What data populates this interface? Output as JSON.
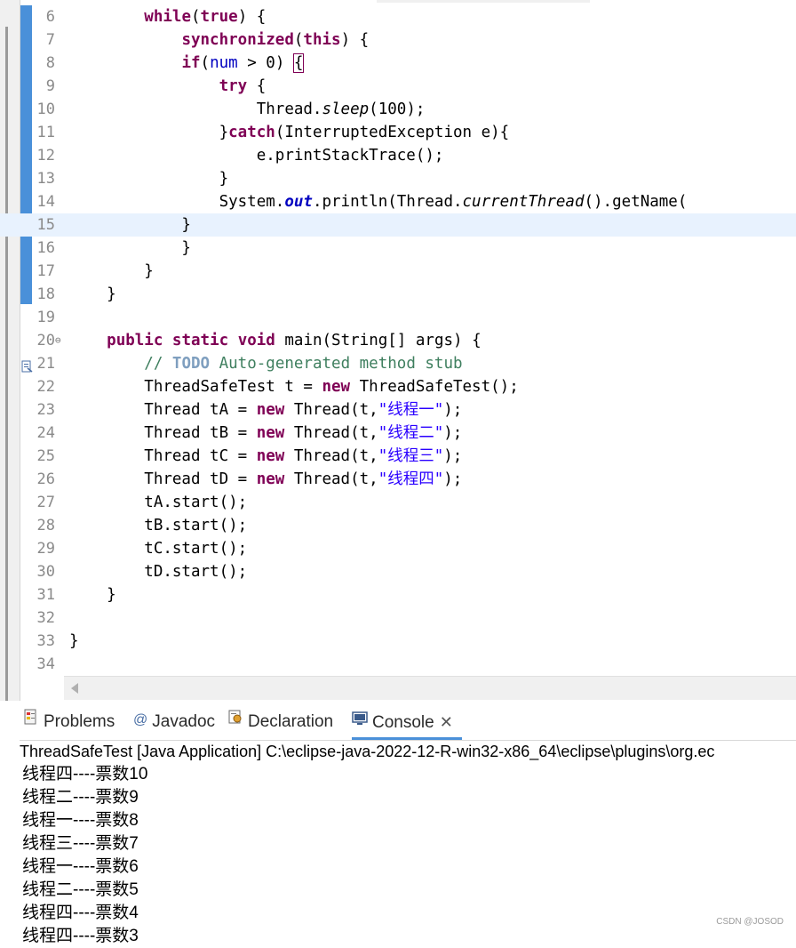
{
  "editor": {
    "lines": [
      {
        "n": "6",
        "html": "        <span class=\"kw\">while</span>(<span class=\"kw\">true</span>) {"
      },
      {
        "n": "7",
        "html": "            <span class=\"kw\">synchronized</span>(<span class=\"kw\">this</span>) {"
      },
      {
        "n": "8",
        "html": "            <span class=\"kw\">if</span>(<span class=\"fld\">num</span> &gt; 0) <span class=\"brk\">{</span>"
      },
      {
        "n": "9",
        "html": "                <span class=\"kw\">try</span> {"
      },
      {
        "n": "10",
        "html": "                    Thread.<span class=\"it\">sleep</span>(100);"
      },
      {
        "n": "11",
        "html": "                }<span class=\"kw\">catch</span>(InterruptedException e){"
      },
      {
        "n": "12",
        "html": "                    e.printStackTrace();"
      },
      {
        "n": "13",
        "html": "                }"
      },
      {
        "n": "14",
        "html": "                System.<span class=\"sf\">out</span>.println(Thread.<span class=\"it\">currentThread</span>().getName("
      },
      {
        "n": "15",
        "html": "            }",
        "current": true
      },
      {
        "n": "16",
        "html": "            }"
      },
      {
        "n": "17",
        "html": "        }"
      },
      {
        "n": "18",
        "html": "    }"
      },
      {
        "n": "19",
        "html": ""
      },
      {
        "n": "20",
        "html": "    <span class=\"kw\">public</span> <span class=\"kw\">static</span> <span class=\"kw\">void</span> main(String[] args) {",
        "fold": "⊖"
      },
      {
        "n": "21",
        "html": "        <span class=\"cm\">// </span><span class=\"td\">TODO</span><span class=\"cm\"> Auto-generated method stub</span>",
        "marker": true
      },
      {
        "n": "22",
        "html": "        ThreadSafeTest t = <span class=\"kw\">new</span> ThreadSafeTest();"
      },
      {
        "n": "23",
        "html": "        Thread tA = <span class=\"kw\">new</span> Thread(t,<span class=\"st\">\"线程一\"</span>);"
      },
      {
        "n": "24",
        "html": "        Thread tB = <span class=\"kw\">new</span> Thread(t,<span class=\"st\">\"线程二\"</span>);"
      },
      {
        "n": "25",
        "html": "        Thread tC = <span class=\"kw\">new</span> Thread(t,<span class=\"st\">\"线程三\"</span>);"
      },
      {
        "n": "26",
        "html": "        Thread tD = <span class=\"kw\">new</span> Thread(t,<span class=\"st\">\"线程四\"</span>);"
      },
      {
        "n": "27",
        "html": "        tA.start();"
      },
      {
        "n": "28",
        "html": "        tB.start();"
      },
      {
        "n": "29",
        "html": "        tC.start();"
      },
      {
        "n": "30",
        "html": "        tD.start();"
      },
      {
        "n": "31",
        "html": "    }"
      },
      {
        "n": "32",
        "html": ""
      },
      {
        "n": "33",
        "html": "}"
      },
      {
        "n": "34",
        "html": ""
      }
    ]
  },
  "tabs": {
    "problems": "Problems",
    "javadoc": "Javadoc",
    "declaration": "Declaration",
    "console": "Console",
    "close": "✕"
  },
  "console": {
    "title": "ThreadSafeTest [Java Application] C:\\eclipse-java-2022-12-R-win32-x86_64\\eclipse\\plugins\\org.ec",
    "output": [
      "线程四----票数10",
      "线程二----票数9",
      "线程一----票数8",
      "线程三----票数7",
      "线程一----票数6",
      "线程二----票数5",
      "线程四----票数4",
      "线程四----票数3"
    ]
  },
  "watermark": "CSDN @JOSOD",
  "colors": {
    "keyword": "#7f0055",
    "string": "#2a00ff",
    "comment": "#3f7f5f",
    "field": "#0000c0",
    "accent": "#4a90d9"
  }
}
